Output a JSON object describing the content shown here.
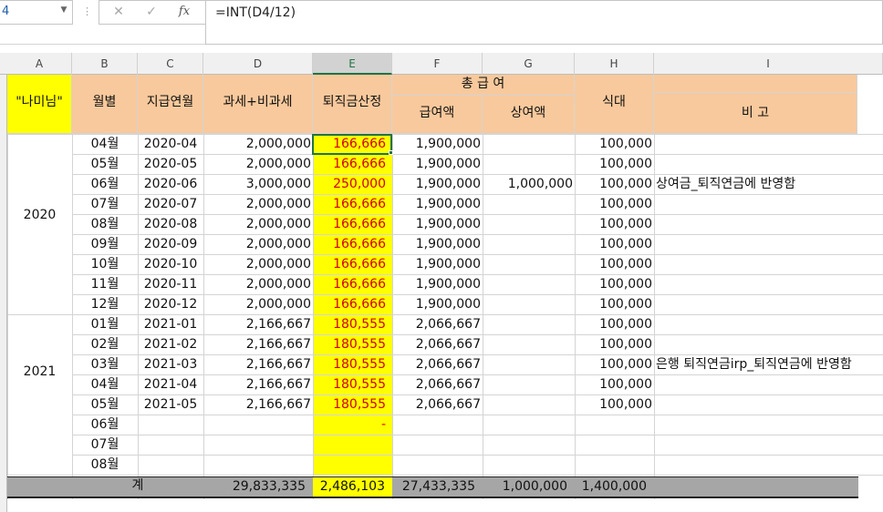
{
  "formula_bar": {
    "name_box": "4",
    "cancel_icon": "✕",
    "enter_icon": "✓",
    "fx_label": "fx",
    "formula": "=INT(D4/12)"
  },
  "columns": [
    "A",
    "B",
    "C",
    "D",
    "E",
    "F",
    "G",
    "H",
    "I"
  ],
  "selected_column": "E",
  "headers": {
    "a": "\"나미님\"",
    "b": "월별",
    "c": "지급연월",
    "d": "과세+비과세",
    "e": "퇴직금산정",
    "total_pay": "총  급  여",
    "f": "급여액",
    "g": "상여액",
    "h": "식대",
    "i": "비  고"
  },
  "year_groups": [
    {
      "year": "2020"
    },
    {
      "year": "2021"
    }
  ],
  "rows": [
    {
      "month": "04월",
      "ym": "2020-04",
      "gross": "2,000,000",
      "severance": "166,666",
      "salary": "1,900,000",
      "bonus": "",
      "meal": "100,000",
      "note": ""
    },
    {
      "month": "05월",
      "ym": "2020-05",
      "gross": "2,000,000",
      "severance": "166,666",
      "salary": "1,900,000",
      "bonus": "",
      "meal": "100,000",
      "note": ""
    },
    {
      "month": "06월",
      "ym": "2020-06",
      "gross": "3,000,000",
      "severance": "250,000",
      "salary": "1,900,000",
      "bonus": "1,000,000",
      "meal": "100,000",
      "note": "상여금_퇴직연금에 반영함"
    },
    {
      "month": "07월",
      "ym": "2020-07",
      "gross": "2,000,000",
      "severance": "166,666",
      "salary": "1,900,000",
      "bonus": "",
      "meal": "100,000",
      "note": ""
    },
    {
      "month": "08월",
      "ym": "2020-08",
      "gross": "2,000,000",
      "severance": "166,666",
      "salary": "1,900,000",
      "bonus": "",
      "meal": "100,000",
      "note": ""
    },
    {
      "month": "09월",
      "ym": "2020-09",
      "gross": "2,000,000",
      "severance": "166,666",
      "salary": "1,900,000",
      "bonus": "",
      "meal": "100,000",
      "note": ""
    },
    {
      "month": "10월",
      "ym": "2020-10",
      "gross": "2,000,000",
      "severance": "166,666",
      "salary": "1,900,000",
      "bonus": "",
      "meal": "100,000",
      "note": ""
    },
    {
      "month": "11월",
      "ym": "2020-11",
      "gross": "2,000,000",
      "severance": "166,666",
      "salary": "1,900,000",
      "bonus": "",
      "meal": "100,000",
      "note": ""
    },
    {
      "month": "12월",
      "ym": "2020-12",
      "gross": "2,000,000",
      "severance": "166,666",
      "salary": "1,900,000",
      "bonus": "",
      "meal": "100,000",
      "note": ""
    },
    {
      "month": "01월",
      "ym": "2021-01",
      "gross": "2,166,667",
      "severance": "180,555",
      "salary": "2,066,667",
      "bonus": "",
      "meal": "100,000",
      "note": ""
    },
    {
      "month": "02월",
      "ym": "2021-02",
      "gross": "2,166,667",
      "severance": "180,555",
      "salary": "2,066,667",
      "bonus": "",
      "meal": "100,000",
      "note": ""
    },
    {
      "month": "03월",
      "ym": "2021-03",
      "gross": "2,166,667",
      "severance": "180,555",
      "salary": "2,066,667",
      "bonus": "",
      "meal": "100,000",
      "note": "은행 퇴직연금irp_퇴직연금에 반영함"
    },
    {
      "month": "04월",
      "ym": "2021-04",
      "gross": "2,166,667",
      "severance": "180,555",
      "salary": "2,066,667",
      "bonus": "",
      "meal": "100,000",
      "note": ""
    },
    {
      "month": "05월",
      "ym": "2021-05",
      "gross": "2,166,667",
      "severance": "180,555",
      "salary": "2,066,667",
      "bonus": "",
      "meal": "100,000",
      "note": ""
    },
    {
      "month": "06월",
      "ym": "",
      "gross": "",
      "severance": "-",
      "salary": "",
      "bonus": "",
      "meal": "",
      "note": ""
    },
    {
      "month": "07월",
      "ym": "",
      "gross": "",
      "severance": "",
      "salary": "",
      "bonus": "",
      "meal": "",
      "note": ""
    },
    {
      "month": "08월",
      "ym": "",
      "gross": "",
      "severance": "",
      "salary": "",
      "bonus": "",
      "meal": "",
      "note": ""
    }
  ],
  "totals": {
    "label": "계",
    "gross": "29,833,335",
    "severance": "2,486,103",
    "salary": "27,433,335",
    "bonus": "1,000,000",
    "meal": "1,400,000"
  },
  "colors": {
    "header_fill": "#f8c99c",
    "label_a_fill": "#ffff00",
    "severance_fill": "#ffff00",
    "severance_text": "#d40000",
    "total_fill": "#a6a6a6",
    "selection": "#217346"
  }
}
